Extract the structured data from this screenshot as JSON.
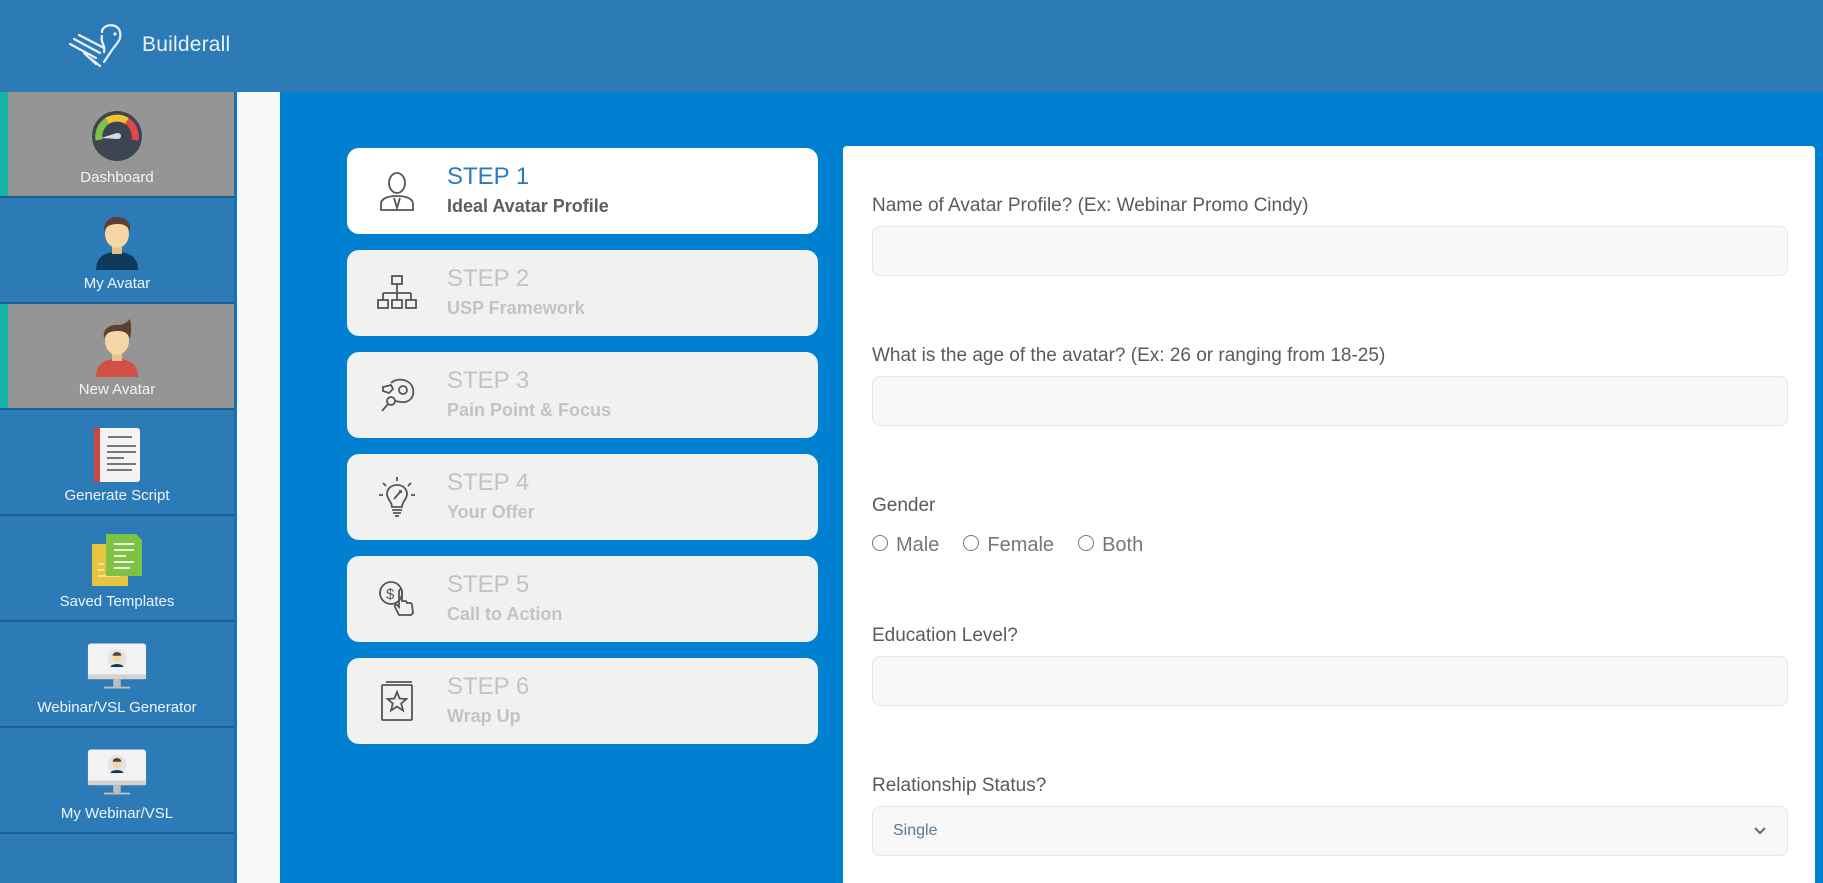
{
  "app": {
    "brand": "Builderall"
  },
  "sidebar": {
    "items": [
      {
        "label": "Dashboard",
        "icon": "gauge-icon",
        "active": true
      },
      {
        "label": "My Avatar",
        "icon": "avatar-man-icon",
        "active": false
      },
      {
        "label": "New Avatar",
        "icon": "avatar-new-icon",
        "active": true
      },
      {
        "label": "Generate Script",
        "icon": "script-document-icon",
        "active": false
      },
      {
        "label": "Saved Templates",
        "icon": "saved-templates-icon",
        "active": false
      },
      {
        "label": "Webinar/VSL Generator",
        "icon": "monitor-avatar-icon",
        "active": false
      },
      {
        "label": "My Webinar/VSL",
        "icon": "monitor-avatar-icon",
        "active": false
      }
    ]
  },
  "steps": [
    {
      "number": "STEP 1",
      "name": "Ideal Avatar Profile",
      "icon": "user-profile-icon",
      "active": true
    },
    {
      "number": "STEP 2",
      "name": "USP Framework",
      "icon": "hierarchy-icon",
      "active": false
    },
    {
      "number": "STEP 3",
      "name": "Pain Point & Focus",
      "icon": "head-magnifier-icon",
      "active": false
    },
    {
      "number": "STEP 4",
      "name": "Your Offer",
      "icon": "lightbulb-icon",
      "active": false
    },
    {
      "number": "STEP 5",
      "name": "Call to Action",
      "icon": "dollar-click-icon",
      "active": false
    },
    {
      "number": "STEP 6",
      "name": "Wrap Up",
      "icon": "star-book-icon",
      "active": false
    }
  ],
  "form": {
    "name_label": "Name of Avatar Profile? (Ex: Webinar Promo Cindy)",
    "name_value": "",
    "age_label": "What is the age of the avatar? (Ex: 26 or ranging from 18-25)",
    "age_value": "",
    "gender_label": "Gender",
    "gender_options": [
      "Male",
      "Female",
      "Both"
    ],
    "education_label": "Education Level?",
    "education_value": "",
    "relationship_label": "Relationship Status?",
    "relationship_selected": "Single"
  },
  "colors": {
    "header": "#2c7bb6",
    "content_bg": "#0080d0",
    "active_accent": "#14b3a7",
    "active_step_text": "#2a7ac0"
  }
}
